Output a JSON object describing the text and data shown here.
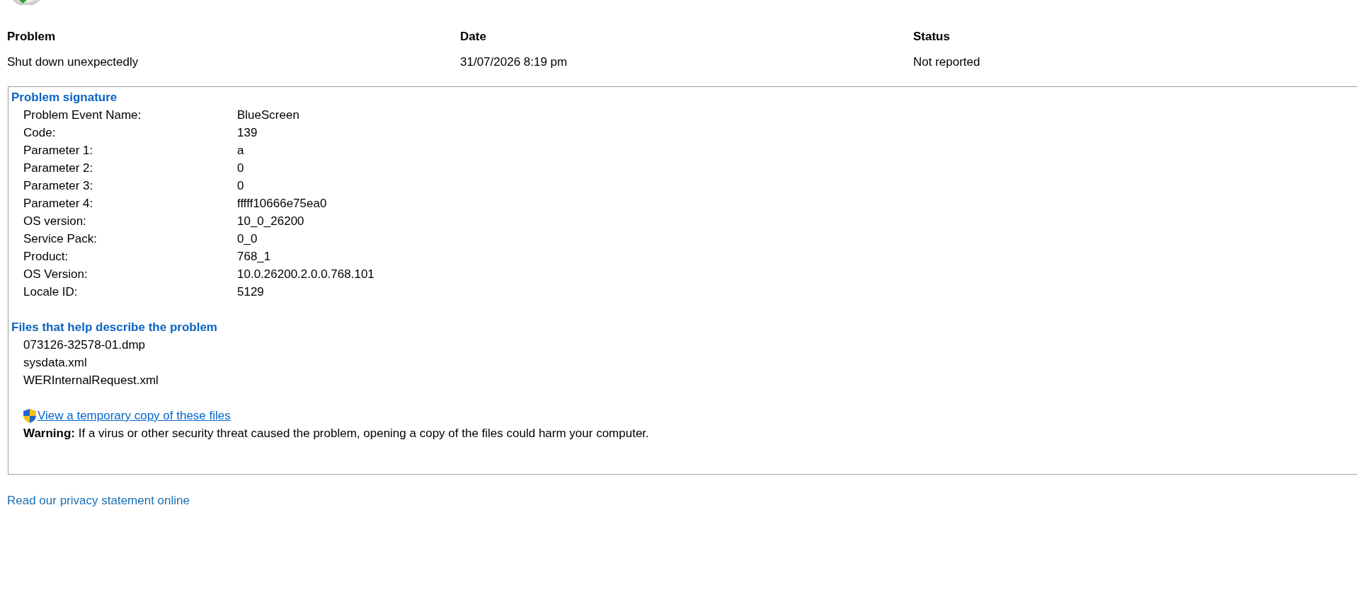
{
  "summary": {
    "columns": [
      "Problem",
      "Date",
      "Status"
    ],
    "values": [
      "Shut down unexpectedly",
      "31/07/2026 8:19 pm",
      "Not reported"
    ]
  },
  "details": {
    "signature_heading": "Problem signature",
    "signature": [
      {
        "label": "Problem Event Name:",
        "value": "BlueScreen"
      },
      {
        "label": "Code:",
        "value": "139"
      },
      {
        "label": "Parameter 1:",
        "value": "a"
      },
      {
        "label": "Parameter 2:",
        "value": "0"
      },
      {
        "label": "Parameter 3:",
        "value": "0"
      },
      {
        "label": "Parameter 4:",
        "value": "fffff10666e75ea0"
      },
      {
        "label": "OS version:",
        "value": "10_0_26200"
      },
      {
        "label": "Service Pack:",
        "value": "0_0"
      },
      {
        "label": "Product:",
        "value": "768_1"
      },
      {
        "label": "OS Version:",
        "value": "10.0.26200.2.0.0.768.101"
      },
      {
        "label": "Locale ID:",
        "value": "5129"
      }
    ],
    "files_heading": "Files that help describe the problem",
    "files": [
      "073126-32578-01.dmp",
      "sysdata.xml",
      "WERInternalRequest.xml"
    ],
    "view_files_link": "View a temporary copy of these files",
    "warning": "**Warning:** If a virus or other security threat caused the problem, opening a copy of the files could harm your computer."
  },
  "privacy_link": "Read our privacy statement online"
}
